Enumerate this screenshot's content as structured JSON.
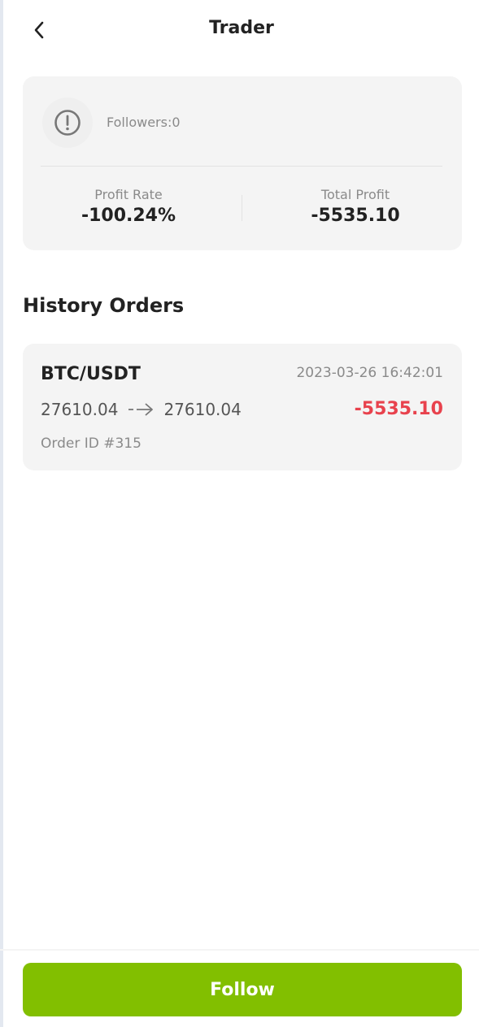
{
  "header": {
    "title": "Trader",
    "back_icon": "chevron-left-icon"
  },
  "trader": {
    "avatar_icon": "exclamation-circle-icon",
    "followers": "Followers:0",
    "profit_rate_label": "Profit Rate",
    "profit_rate_value": "-100.24%",
    "total_profit_label": "Total Profit",
    "total_profit_value": "-5535.10"
  },
  "history": {
    "title": "History Orders",
    "orders": [
      {
        "pair": "BTC/USDT",
        "time": "2023-03-26 16:42:01",
        "open_price": "27610.04",
        "close_price": "27610.04",
        "profit": "-5535.10",
        "order_id": "Order ID #315"
      }
    ]
  },
  "footer": {
    "follow_label": "Follow"
  },
  "colors": {
    "accent": "#82bf00",
    "loss": "#e8424d",
    "card_bg": "#f4f4f4",
    "muted_text": "#8a8a8a"
  }
}
